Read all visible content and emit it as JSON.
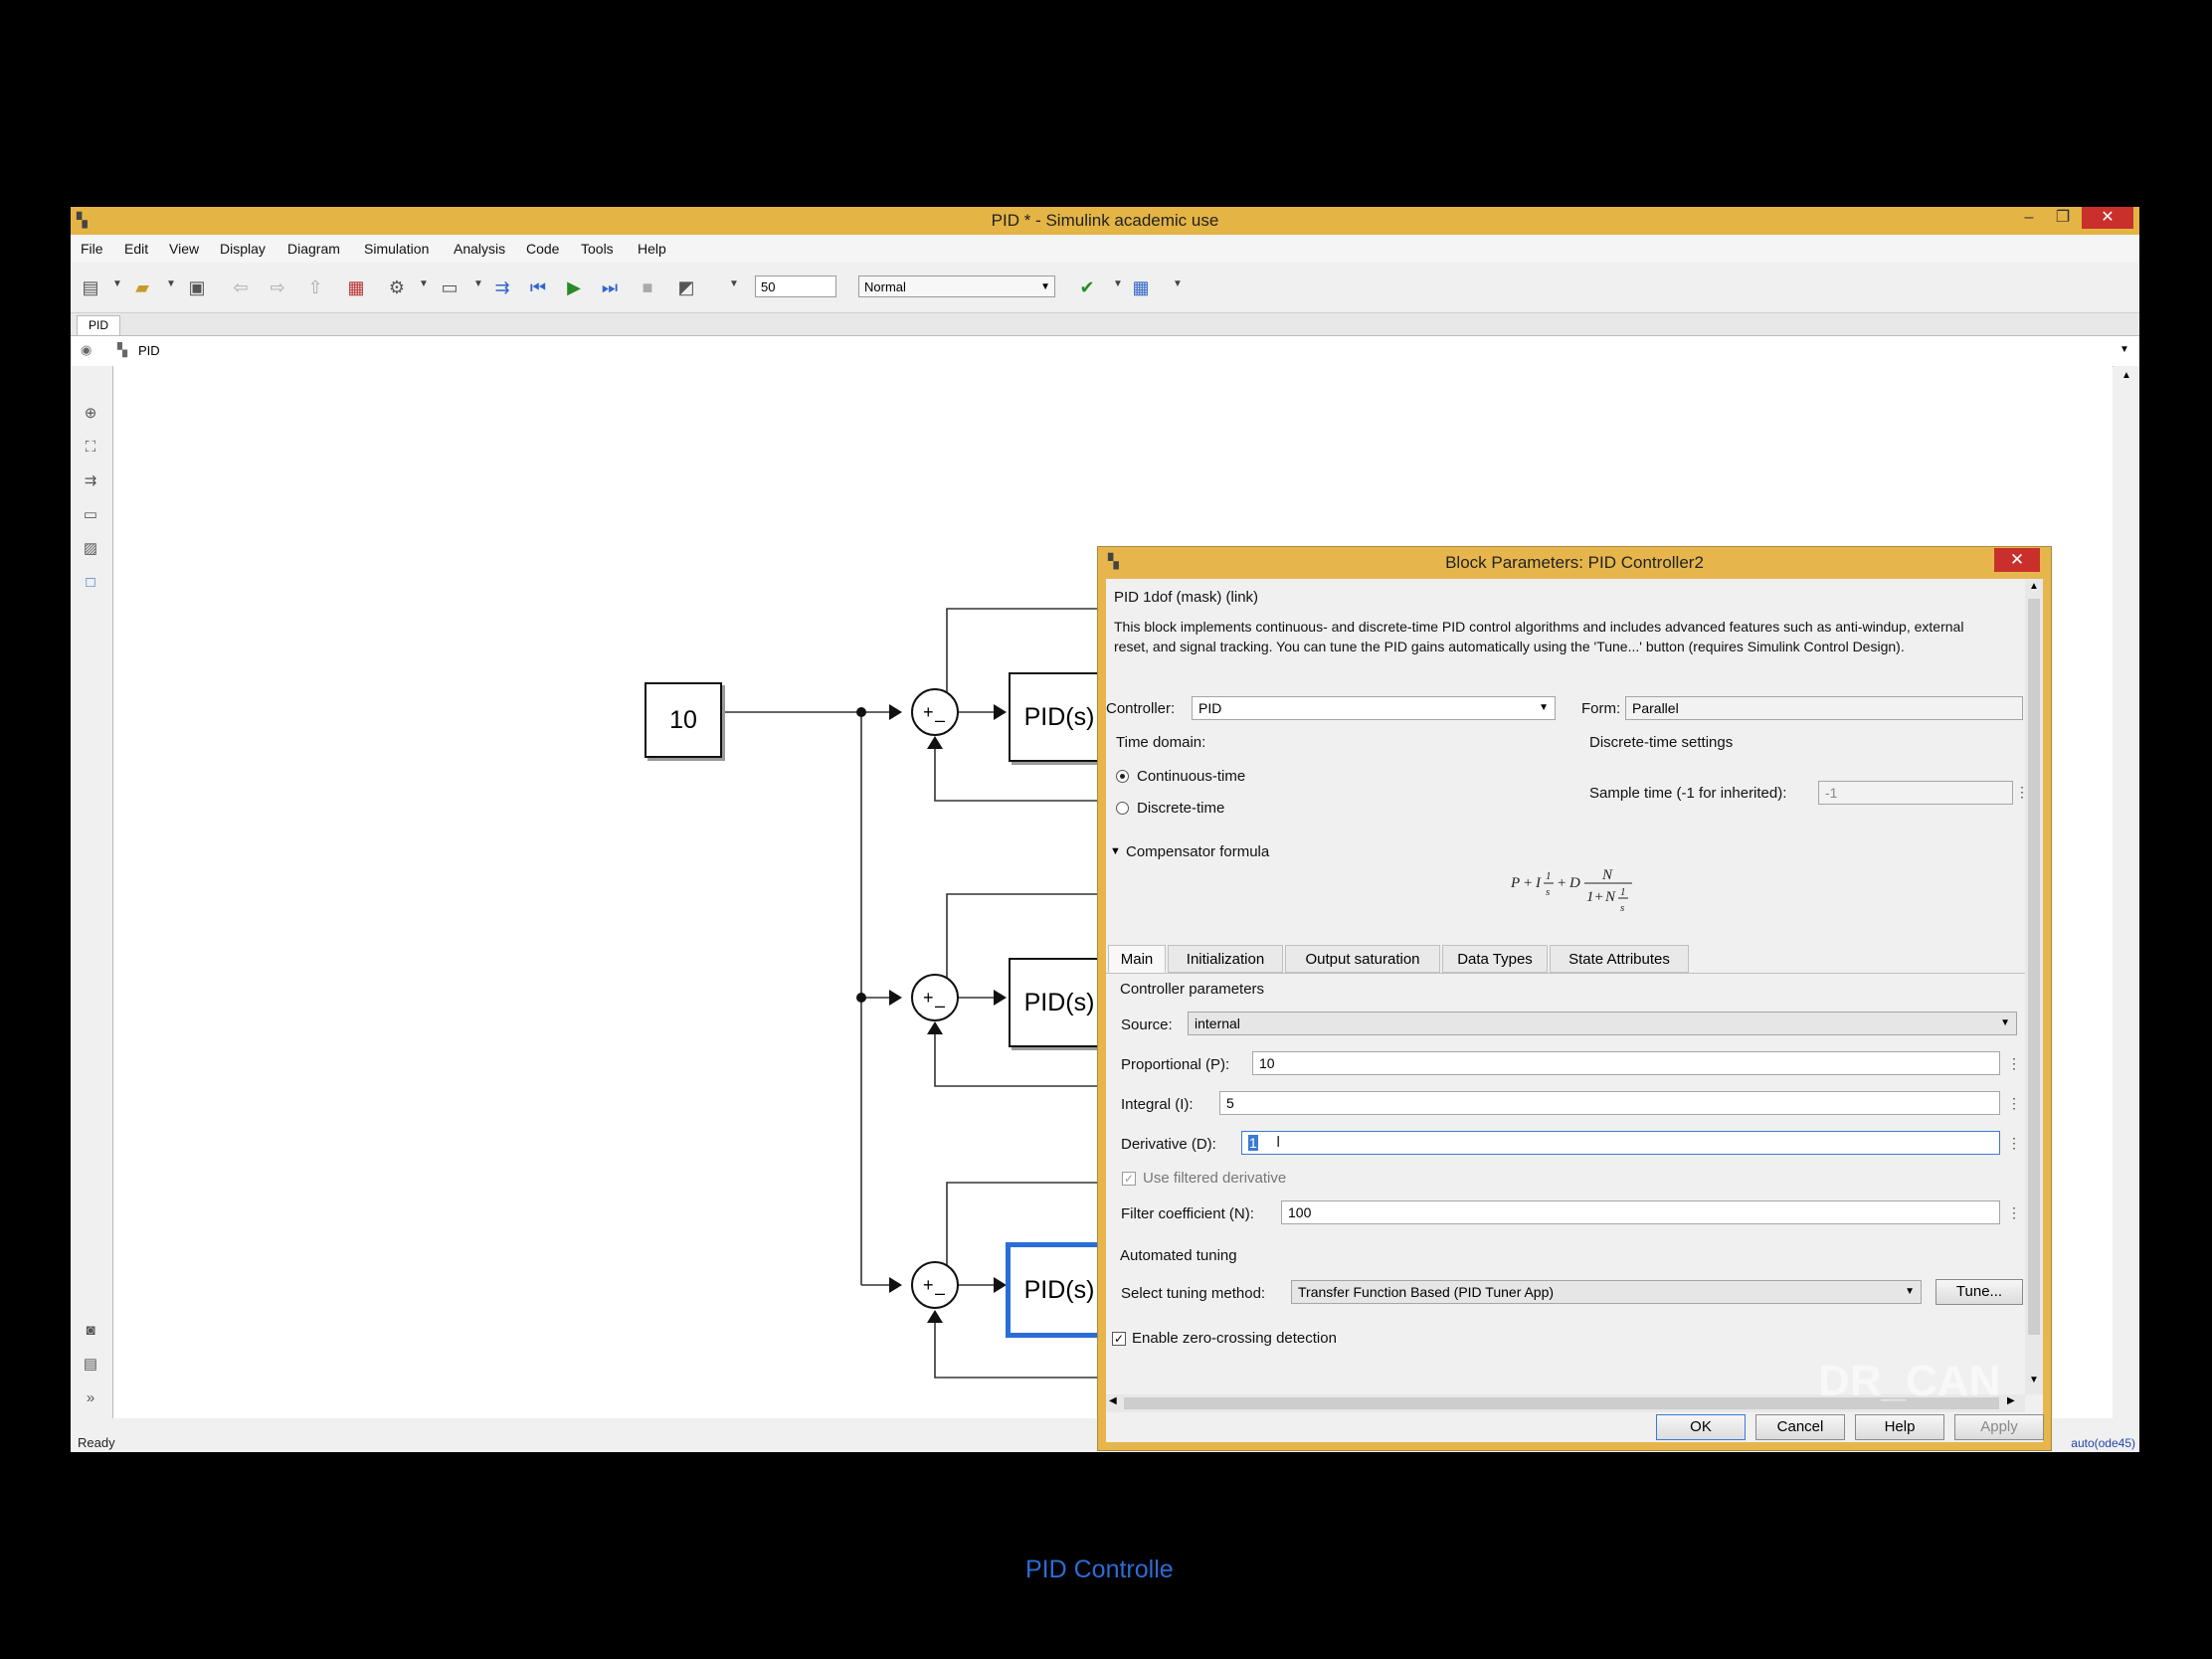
{
  "window": {
    "title": "PID * - Simulink academic use",
    "minimize": "–",
    "restore": "❐",
    "close": "✕"
  },
  "menu": [
    "File",
    "Edit",
    "View",
    "Display",
    "Diagram",
    "Simulation",
    "Analysis",
    "Code",
    "Tools",
    "Help"
  ],
  "toolbar": {
    "stop_time": "50",
    "sim_mode": "Normal"
  },
  "tab": {
    "label": "PID"
  },
  "address": {
    "path": "PID"
  },
  "diagram": {
    "constant_value": "10",
    "pid_label": "PID(s)",
    "selected_block_name": "PID Controlle",
    "sum_plus": "+",
    "sum_minus": "–"
  },
  "status": {
    "text": "Ready",
    "solver": "auto(ode45)"
  },
  "dialog": {
    "title": "Block Parameters: PID Controller2",
    "close": "✕",
    "mask_heading": "PID 1dof (mask) (link)",
    "description": "This block implements continuous- and discrete-time PID control algorithms and includes advanced features such as anti-windup, external reset, and signal tracking. You can tune the PID gains automatically using the 'Tune...' button (requires Simulink Control Design).",
    "controller_label": "Controller:",
    "controller_value": "PID",
    "form_label": "Form:",
    "form_value": "Parallel",
    "time_domain_label": "Time domain:",
    "continuous_label": "Continuous-time",
    "discrete_label": "Discrete-time",
    "discrete_settings_label": "Discrete-time settings",
    "sample_time_label": "Sample time (-1 for inherited):",
    "sample_time_value": "-1",
    "compensator_label": "Compensator formula",
    "tabs": [
      "Main",
      "Initialization",
      "Output saturation",
      "Data Types",
      "State Attributes"
    ],
    "controller_params_label": "Controller parameters",
    "source_label": "Source:",
    "source_value": "internal",
    "p_label": "Proportional (P):",
    "p_value": "10",
    "i_label": "Integral (I):",
    "i_value": "5",
    "d_label": "Derivative (D):",
    "d_value": "1",
    "filtered_label": "Use filtered derivative",
    "n_label": "Filter coefficient (N):",
    "n_value": "100",
    "auto_tuning_label": "Automated tuning",
    "tuning_method_label": "Select tuning method:",
    "tuning_method_value": "Transfer Function Based (PID Tuner App)",
    "tune_button": "Tune...",
    "zero_crossing_label": "Enable zero-crossing detection",
    "ok": "OK",
    "cancel": "Cancel",
    "help": "Help",
    "apply": "Apply"
  },
  "watermark": "DR_CAN"
}
